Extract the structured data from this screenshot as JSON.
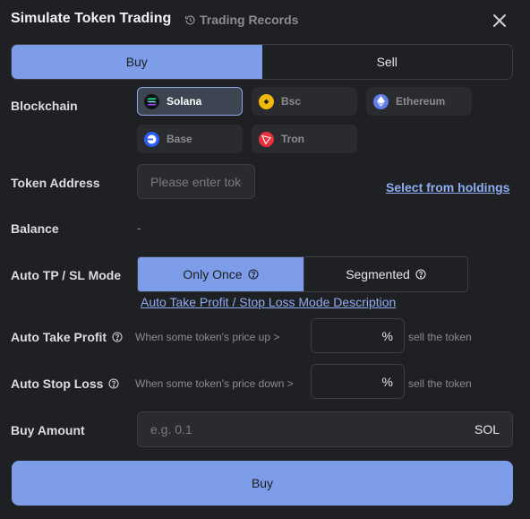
{
  "header": {
    "title": "Simulate Token Trading",
    "records_label": "Trading Records",
    "records_icon": "history-icon",
    "close_icon": "close-icon"
  },
  "tabs": [
    {
      "label": "Buy",
      "active": true
    },
    {
      "label": "Sell",
      "active": false
    }
  ],
  "blockchain": {
    "label": "Blockchain",
    "options": [
      {
        "name": "Solana",
        "icon": "solana-icon",
        "selected": true
      },
      {
        "name": "Bsc",
        "icon": "bsc-icon",
        "selected": false
      },
      {
        "name": "Ethereum",
        "icon": "ethereum-icon",
        "selected": false
      },
      {
        "name": "Base",
        "icon": "base-icon",
        "selected": false
      },
      {
        "name": "Tron",
        "icon": "tron-icon",
        "selected": false
      }
    ]
  },
  "token_address": {
    "label": "Token Address",
    "placeholder": "Please enter token address",
    "value": "",
    "select_link": "Select from holdings"
  },
  "balance": {
    "label": "Balance",
    "value": "-"
  },
  "mode": {
    "label": "Auto TP / SL Mode",
    "options": [
      {
        "label": "Only Once",
        "selected": true
      },
      {
        "label": "Segmented",
        "selected": false
      }
    ],
    "description_link": "Auto Take Profit / Stop Loss Mode Description"
  },
  "take_profit": {
    "label": "Auto Take Profit",
    "condition": "When some token's price up >",
    "value": "",
    "unit": "%",
    "suffix": "sell the token"
  },
  "stop_loss": {
    "label": "Auto Stop Loss",
    "condition": "When some token's price down >",
    "value": "",
    "unit": "%",
    "suffix": "sell the token"
  },
  "buy_amount": {
    "label": "Buy Amount",
    "placeholder": "e.g. 0.1",
    "value": "",
    "unit": "SOL"
  },
  "submit": {
    "label": "Buy"
  },
  "colors": {
    "background": "#1f2023",
    "accent": "#7d9de8",
    "link": "#8eacf0",
    "muted": "#8b8c92"
  }
}
